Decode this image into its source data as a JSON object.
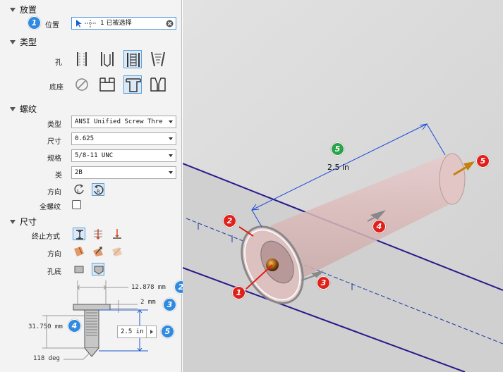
{
  "sections": {
    "placement": "放置",
    "type": "类型",
    "thread": "螺纹",
    "dimensions": "尺寸"
  },
  "placement": {
    "position_label": "位置",
    "position_value": "1 已被选择"
  },
  "type": {
    "hole_label": "孔",
    "seat_label": "底座"
  },
  "thread": {
    "type_label": "类型",
    "type_value": "ANSI Unified Screw Thre",
    "size_label": "尺寸",
    "size_value": "0.625",
    "designation_label": "规格",
    "designation_value": "5/8-11 UNC",
    "class_label": "类",
    "class_value": "2B",
    "direction_label": "方向",
    "full_thread_label": "全螺纹"
  },
  "dimensions": {
    "termination_label": "终止方式",
    "direction_label": "方向",
    "bottom_label": "孔底",
    "diameter": "12.878 mm",
    "depth_cb": "2 mm",
    "thread_depth": "31.750 mm",
    "hole_depth": "2.5 in",
    "angle": "118 deg"
  },
  "viewport": {
    "length_label": "2.5 in"
  },
  "badges": {
    "b1": "1",
    "b2": "2",
    "b3": "3",
    "b4": "4",
    "b5": "5"
  },
  "colors": {
    "accent": "#2f8ae0",
    "red": "#e0201a",
    "green": "#2aa34a",
    "edge": "#2a1a8a",
    "dim": "#1a4ad8"
  }
}
